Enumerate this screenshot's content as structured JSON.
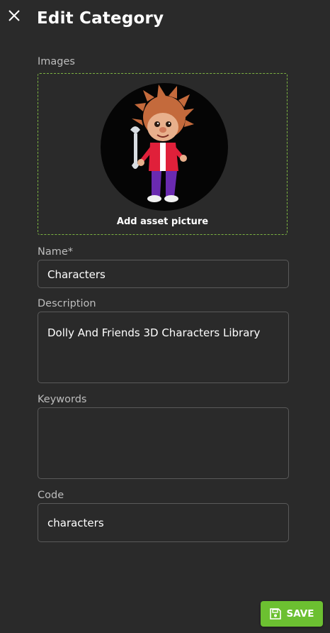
{
  "header": {
    "close_icon": "close-icon",
    "title": "Edit Category"
  },
  "images": {
    "label": "Images",
    "add_picture_label": "Add asset picture",
    "accent_color": "#7cb342"
  },
  "form": {
    "name": {
      "label": "Name",
      "required_marker": "*",
      "value": "Characters"
    },
    "description": {
      "label": "Description",
      "value": "Dolly And Friends 3D Characters Library"
    },
    "keywords": {
      "label": "Keywords",
      "value": ""
    },
    "code": {
      "label": "Code",
      "value": "characters"
    }
  },
  "footer": {
    "save_label": "SAVE",
    "save_icon": "floppy-disk-icon",
    "save_color": "#6cc031"
  }
}
